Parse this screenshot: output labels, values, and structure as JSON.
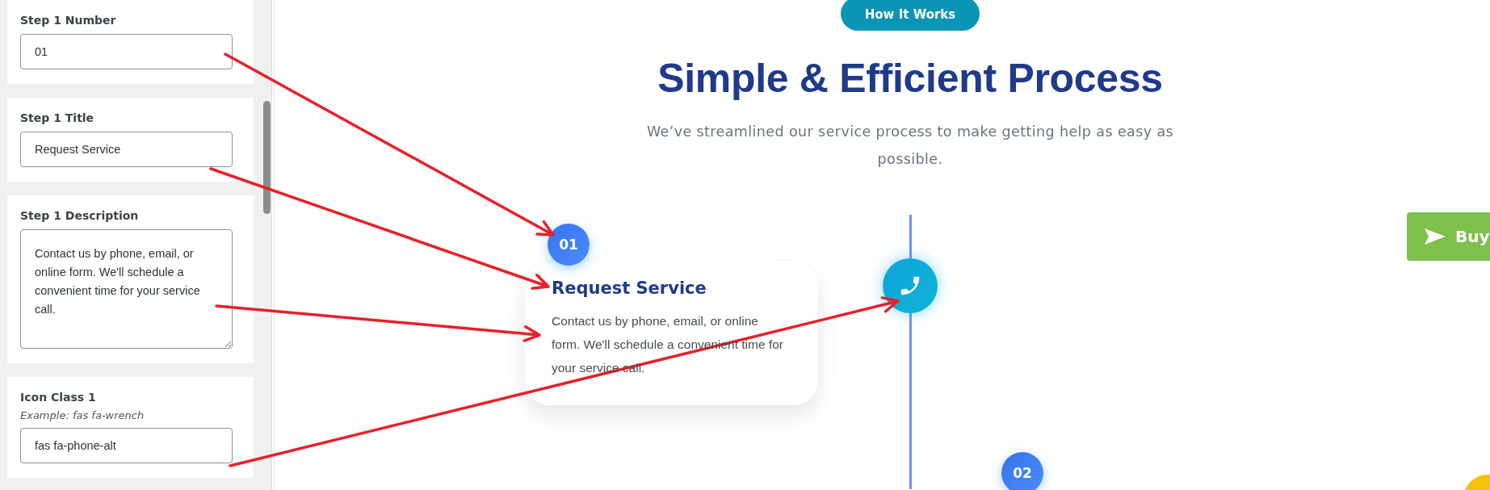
{
  "sidebar": {
    "fields": [
      {
        "kind": "input",
        "label": "Step 1 Number",
        "value": "01"
      },
      {
        "kind": "input",
        "label": "Step 1 Title",
        "value": "Request Service"
      },
      {
        "kind": "textarea",
        "label": "Step 1 Description",
        "value": "Contact us by phone, email, or online form. We'll schedule a convenient time for your service call."
      },
      {
        "kind": "input",
        "label": "Icon Class 1",
        "hint": "Example: fas fa-wrench",
        "value": "fas fa-phone-alt"
      }
    ]
  },
  "preview": {
    "badge": "How It Works",
    "title": "Simple & Efficient Process",
    "subtitle": "We’ve streamlined our service process to make getting help as easy as possible.",
    "steps": [
      {
        "number": "01",
        "title": "Request Service",
        "description": "Contact us by phone, email, or online form. We'll schedule a convenient time for your service call."
      },
      {
        "number": "02"
      }
    ]
  },
  "buy_button": {
    "label": "Buy"
  }
}
